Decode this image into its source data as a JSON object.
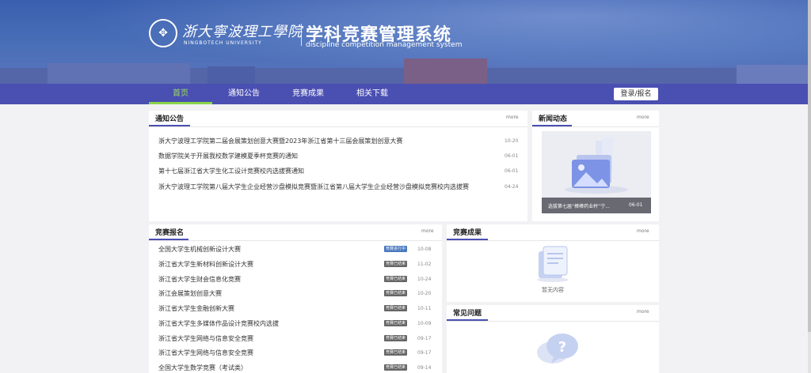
{
  "header": {
    "school_cn": "浙大寧波理工學院",
    "school_en": "NINGBOTECH UNIVERSITY",
    "system_cn": "学科竞赛管理系统",
    "system_en": "discipline competition management system"
  },
  "nav": {
    "items": [
      "首页",
      "通知公告",
      "竞赛成果",
      "相关下载"
    ],
    "active": "首页",
    "login": "登录/报名"
  },
  "notices": {
    "title": "通知公告",
    "more": "more",
    "items": [
      {
        "text": "浙大宁波理工学院第二届会展策划创意大赛暨2023年浙江省第十三届会展策划创意大赛",
        "date": "10-20"
      },
      {
        "text": "数据学院关于开展我校数学建模夏季杯竞赛的通知",
        "date": "06-01"
      },
      {
        "text": "第十七届浙江省大学生化工设计竞赛校内选拔赛通知",
        "date": "06-01"
      },
      {
        "text": "浙大宁波理工学院第八届大学生企业经营沙盘模拟竞赛暨浙江省第八届大学生企业经营沙盘模拟竞赛校内选拔赛",
        "date": "04-24"
      }
    ]
  },
  "news": {
    "title": "新闻动态",
    "more": "more",
    "caption": "选拔第七届“棒棒药业杯”宁...",
    "date": "06-01"
  },
  "signup": {
    "title": "竞赛报名",
    "more": "more",
    "items": [
      {
        "text": "全国大学生机械创新设计大赛",
        "status": "竞赛进行中",
        "date": "10-08",
        "active": true
      },
      {
        "text": "浙江省大学生新材料创新设计大赛",
        "status": "竞赛已结束",
        "date": "11-02",
        "active": false
      },
      {
        "text": "浙江省大学生财会信息化竞赛",
        "status": "竞赛已结束",
        "date": "10-24",
        "active": false
      },
      {
        "text": "浙江会展策划创意大赛",
        "status": "竞赛已结束",
        "date": "10-20",
        "active": false
      },
      {
        "text": "浙江省大学生金融创新大赛",
        "status": "竞赛已结束",
        "date": "10-11",
        "active": false
      },
      {
        "text": "浙江省大学生多媒体作品设计竞赛校内选拔",
        "status": "竞赛已结束",
        "date": "10-09",
        "active": false
      },
      {
        "text": "浙江省大学生网络与信息安全竞赛",
        "status": "竞赛已结束",
        "date": "09-17",
        "active": false
      },
      {
        "text": "浙江省大学生网络与信息安全竞赛",
        "status": "竞赛已结束",
        "date": "09-17",
        "active": false
      },
      {
        "text": "全国大学生数学竞赛（考试类）",
        "status": "竞赛已结束",
        "date": "09-14",
        "active": false
      }
    ]
  },
  "results": {
    "title": "竞赛成果",
    "more": "more",
    "empty": "暂无内容"
  },
  "faq": {
    "title": "常见问题",
    "more": "more"
  },
  "colors": {
    "nav": "#4a4fb2",
    "accent_green": "#8bd44a",
    "badge_active": "#4a78c0"
  }
}
